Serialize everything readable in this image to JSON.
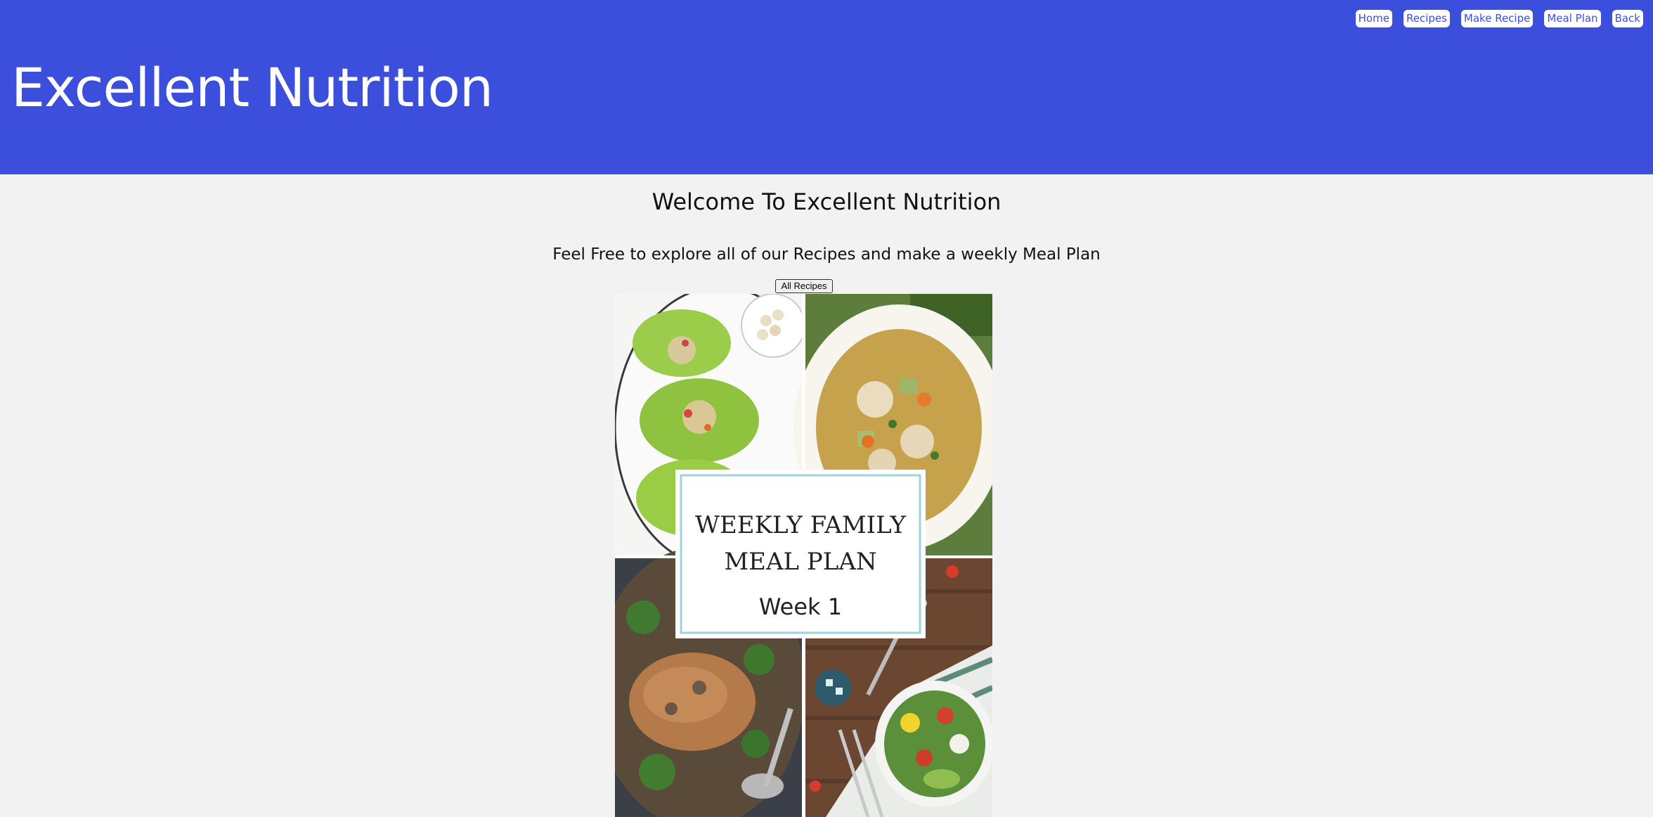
{
  "header": {
    "title": "Excellent Nutrition",
    "background_color": "#3b4edc"
  },
  "nav": {
    "items": [
      {
        "label": "Home"
      },
      {
        "label": "Recipes"
      },
      {
        "label": "Make Recipe"
      },
      {
        "label": "Meal Plan"
      },
      {
        "label": "Back"
      }
    ]
  },
  "main": {
    "welcome_heading": "Welcome To Excellent Nutrition",
    "intro_text": "Feel Free to explore all of our Recipes and make a weekly Meal Plan",
    "all_recipes_button": "All Recipes"
  },
  "promo_image": {
    "card_line_1": "WEEKLY FAMILY",
    "card_line_2": "MEAL PLAN",
    "card_line_3": "Week 1",
    "card_border_color": "#9dd4d9"
  }
}
